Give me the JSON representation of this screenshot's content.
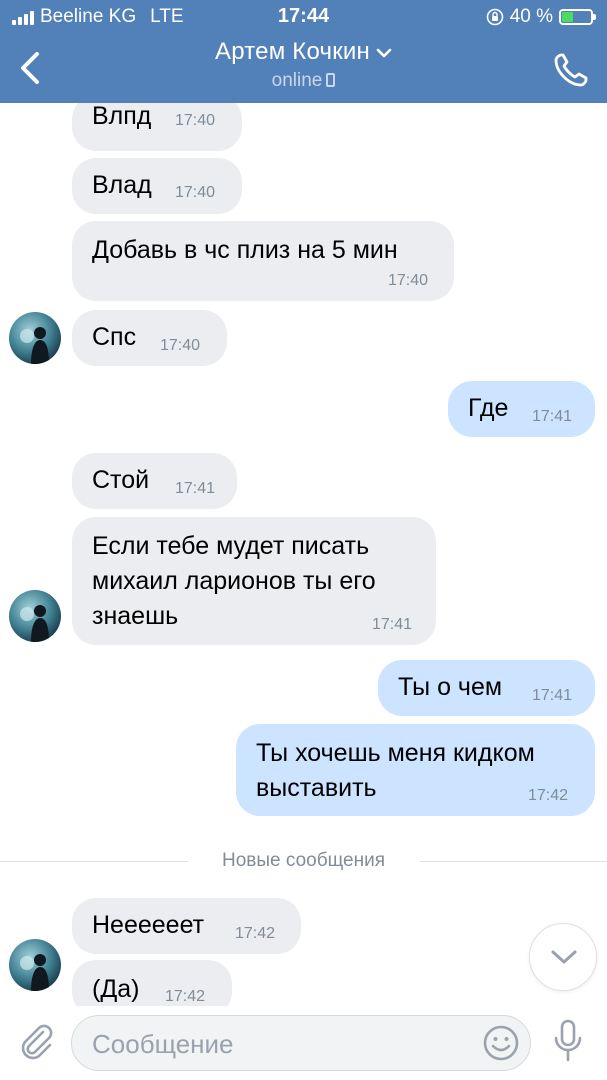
{
  "status_bar": {
    "carrier": "Beeline KG",
    "network": "LTE",
    "time": "17:44",
    "battery": "40 %",
    "battery_level": 0.4,
    "colors": {
      "bar": "#5181b8",
      "battery_fill": "#4cd964"
    }
  },
  "header": {
    "title": "Артем Кочкин",
    "status": "online"
  },
  "messages": [
    {
      "direction": "in",
      "text": "Влпд",
      "time": "17:40"
    },
    {
      "direction": "in",
      "text": "Влад",
      "time": "17:40"
    },
    {
      "direction": "in",
      "text": "Добавь в чс плиз на 5 мин",
      "time": "17:40"
    },
    {
      "direction": "in",
      "text": "Спс",
      "time": "17:40"
    },
    {
      "direction": "out",
      "text": "Где",
      "time": "17:41"
    },
    {
      "direction": "in",
      "text": "Стой",
      "time": "17:41"
    },
    {
      "direction": "in",
      "lines": [
        "Если тебе мудет писать",
        "михаил ларионов ты его",
        "знаешь"
      ],
      "time": "17:41"
    },
    {
      "direction": "out",
      "text": "Ты о чем",
      "time": "17:41"
    },
    {
      "direction": "out",
      "lines": [
        "Ты хочешь меня кидком",
        "выставить"
      ],
      "time": "17:42"
    },
    {
      "direction": "in",
      "text": "Неееееет",
      "time": "17:42"
    },
    {
      "direction": "in",
      "text": "(Да)",
      "time": "17:42"
    }
  ],
  "divider": {
    "label": "Новые сообщения"
  },
  "composer": {
    "placeholder": "Сообщение"
  },
  "icons": {
    "back": "chevron-left-icon",
    "title_dropdown": "chevron-down-icon",
    "call": "phone-icon",
    "scroll_down": "chevron-down-icon",
    "attach": "paperclip-icon",
    "emoji": "smiley-icon",
    "mic": "microphone-icon"
  }
}
